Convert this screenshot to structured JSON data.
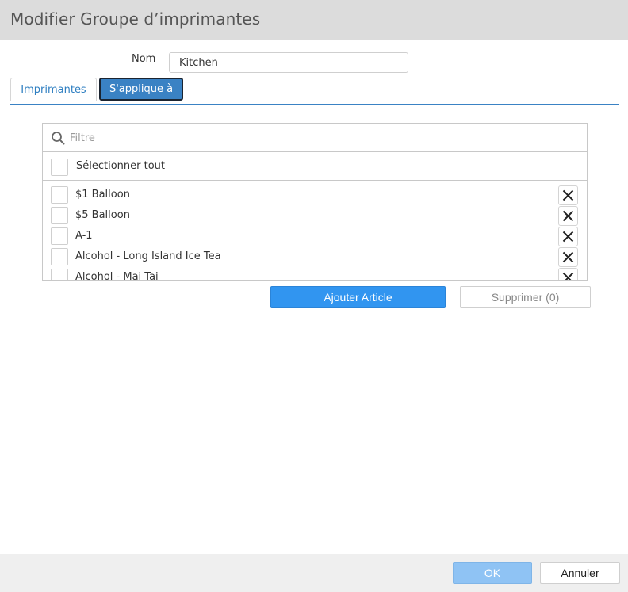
{
  "dialog": {
    "title": "Modifier Groupe d’imprimantes"
  },
  "form": {
    "name_label": "Nom",
    "name_value": "Kitchen"
  },
  "tabs": [
    {
      "label": "Imprimantes",
      "active": false
    },
    {
      "label": "S'applique à",
      "active": true
    }
  ],
  "list": {
    "filter_placeholder": "Filtre",
    "select_all_label": "Sélectionner tout",
    "items": [
      {
        "label": "$1 Balloon",
        "checked": false
      },
      {
        "label": "$5 Balloon",
        "checked": false
      },
      {
        "label": "A-1",
        "checked": false
      },
      {
        "label": "Alcohol - Long Island Ice Tea",
        "checked": false
      },
      {
        "label": "Alcohol - Mai Tai",
        "checked": false
      }
    ]
  },
  "actions": {
    "add_label": "Ajouter Article",
    "delete_label": "Supprimer (0)"
  },
  "footer": {
    "ok_label": "OK",
    "cancel_label": "Annuler"
  },
  "icons": {
    "search": "search-icon",
    "remove": "close-icon"
  },
  "colors": {
    "accent": "#3a82c4",
    "primary_button": "#3195f0",
    "ok_button_disabled": "#8fc3f4",
    "title_bar": "#dcdcdc",
    "footer_bar": "#efefef"
  }
}
